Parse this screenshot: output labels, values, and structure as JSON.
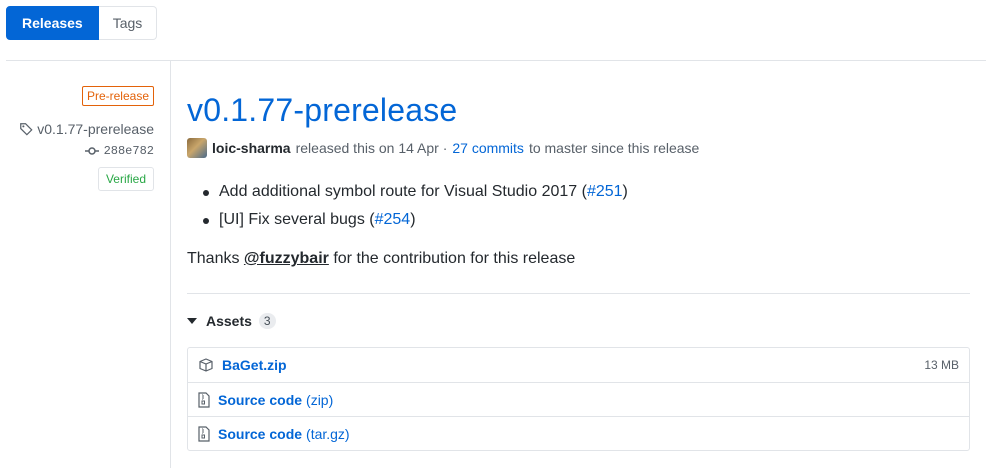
{
  "tabs": {
    "releases": "Releases",
    "tags": "Tags"
  },
  "meta": {
    "prerelease_badge": "Pre-release",
    "tag": "v0.1.77-prerelease",
    "commit": "288e782",
    "verified": "Verified"
  },
  "release": {
    "title": "v0.1.77-prerelease",
    "author": "loic-sharma",
    "released_text": "released this on 14 Apr ·",
    "commits_link": "27 commits",
    "since_text": "to master since this release",
    "notes": [
      {
        "text": "Add additional symbol route for Visual Studio 2017 (",
        "ref": "#251",
        "close": ")"
      },
      {
        "text": "[UI] Fix several bugs (",
        "ref": "#254",
        "close": ")"
      }
    ],
    "thanks_prefix": "Thanks",
    "mention": "@fuzzybair",
    "thanks_suffix": "for the contribution for this release"
  },
  "assets": {
    "label": "Assets",
    "count": "3",
    "items": [
      {
        "name": "BaGet.zip",
        "ext": "",
        "size": "13 MB",
        "icon": "package-icon"
      },
      {
        "name": "Source code",
        "ext": "(zip)",
        "size": "",
        "icon": "file-zip-icon"
      },
      {
        "name": "Source code",
        "ext": "(tar.gz)",
        "size": "",
        "icon": "file-zip-icon"
      }
    ]
  },
  "colors": {
    "accent": "#0366d6",
    "prerelease": "#e36209",
    "verified": "#28a745"
  }
}
